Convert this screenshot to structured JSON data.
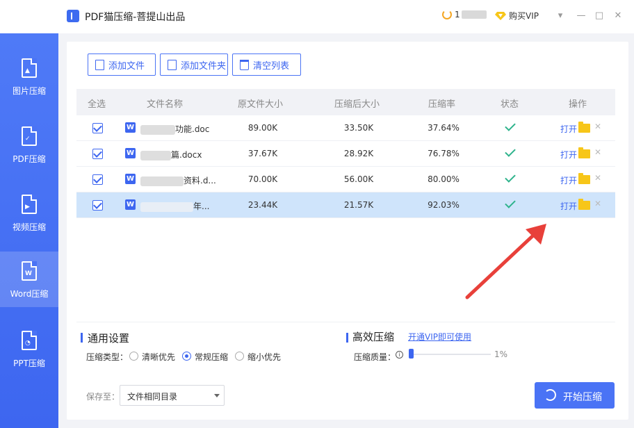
{
  "app": {
    "title": "PDF猫压缩-菩提山出品"
  },
  "user": {
    "name_prefix": "1"
  },
  "vip": {
    "label": "购买VIP"
  },
  "window": {
    "minimize": "—",
    "restore": "□",
    "close": "✕",
    "menu": "▾"
  },
  "sidebar": {
    "items": [
      {
        "label": "图片压缩",
        "glyph": "▲"
      },
      {
        "label": "PDF压缩",
        "glyph": "✓"
      },
      {
        "label": "视频压缩",
        "glyph": "▶"
      },
      {
        "label": "Word压缩",
        "glyph": "W"
      },
      {
        "label": "PPT压缩",
        "glyph": "◔"
      }
    ]
  },
  "toolbar": {
    "add_file": "添加文件",
    "add_folder": "添加文件夹",
    "clear_list": "清空列表"
  },
  "table": {
    "headers": [
      "全选",
      "文件名称",
      "原文件大小",
      "压缩后大小",
      "压缩率",
      "状态",
      "操作"
    ],
    "rows": [
      {
        "name": "功能.doc",
        "orig": "89.00K",
        "comp": "33.50K",
        "ratio": "37.64%",
        "open": "打开"
      },
      {
        "name": "篇.docx",
        "orig": "37.67K",
        "comp": "28.92K",
        "ratio": "76.78%",
        "open": "打开"
      },
      {
        "name": "资料.d...",
        "orig": "70.00K",
        "comp": "56.00K",
        "ratio": "80.00%",
        "open": "打开"
      },
      {
        "name": "年...",
        "orig": "23.44K",
        "comp": "21.57K",
        "ratio": "92.03%",
        "open": "打开"
      }
    ]
  },
  "settings": {
    "general_title": "通用设置",
    "type_label": "压缩类型：",
    "options": [
      "清晰优先",
      "常规压缩",
      "缩小优先"
    ],
    "selected_option": "常规压缩",
    "efficient_title": "高效压缩",
    "vip_link": "开通VIP即可使用",
    "quality_label": "压缩质量：",
    "quality_value": "1%",
    "quality_fraction": 0.01
  },
  "footer": {
    "save_label": "保存至：",
    "save_option": "文件相同目录",
    "start_button": "开始压缩"
  },
  "colors": {
    "accent": "#3d66f0",
    "arrow": "#e8403a",
    "folder": "#f7c619",
    "check": "#2eb38c"
  }
}
